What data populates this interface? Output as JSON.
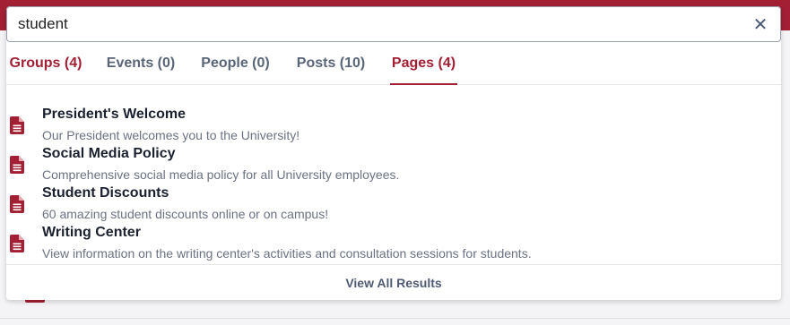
{
  "search": {
    "value": "student",
    "close_icon": "close-icon"
  },
  "tabs": [
    {
      "label": "Groups (4)"
    },
    {
      "label": "Events (0)"
    },
    {
      "label": "People (0)"
    },
    {
      "label": "Posts (10)"
    },
    {
      "label": "Pages (4)"
    }
  ],
  "active_tab": "Pages (4)",
  "results": [
    {
      "title": "President's Welcome",
      "description": "Our President welcomes you to the University!",
      "icon": "document-icon"
    },
    {
      "title": "Social Media Policy",
      "description": "Comprehensive social media policy for all University employees.",
      "icon": "document-icon"
    },
    {
      "title": "Student Discounts",
      "description": "60 amazing student discounts online or on campus!",
      "icon": "document-icon"
    },
    {
      "title": "Writing Center",
      "description": "View information on the writing center's activities and consultation sessions for students.",
      "icon": "document-icon"
    }
  ],
  "footer": {
    "view_all_label": "View All Results"
  },
  "colors": {
    "brand": "#a31f34",
    "text_dark": "#1c2130",
    "text_muted": "#6c7283",
    "tab_inactive": "#5a6578"
  }
}
